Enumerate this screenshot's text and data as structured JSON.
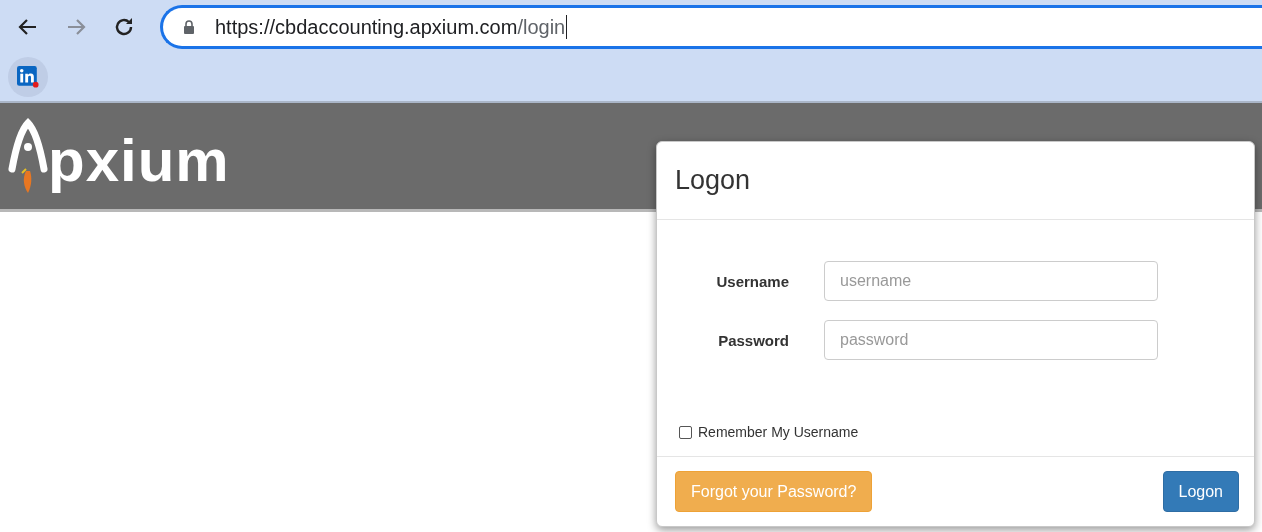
{
  "browser": {
    "url_host": "https://cbdaccounting.apxium.com",
    "url_path": "/login",
    "forward_disabled": true
  },
  "logo": {
    "text": "pxium"
  },
  "dialog": {
    "title": "Logon",
    "fields": [
      {
        "label": "Username",
        "placeholder": "username"
      },
      {
        "label": "Password",
        "placeholder": "password"
      }
    ],
    "remember": {
      "label": "Remember My Username",
      "checked": false
    },
    "buttons": [
      {
        "label": "Forgot your Password?",
        "kind": "warning"
      },
      {
        "label": "Logon",
        "kind": "primary"
      }
    ]
  }
}
